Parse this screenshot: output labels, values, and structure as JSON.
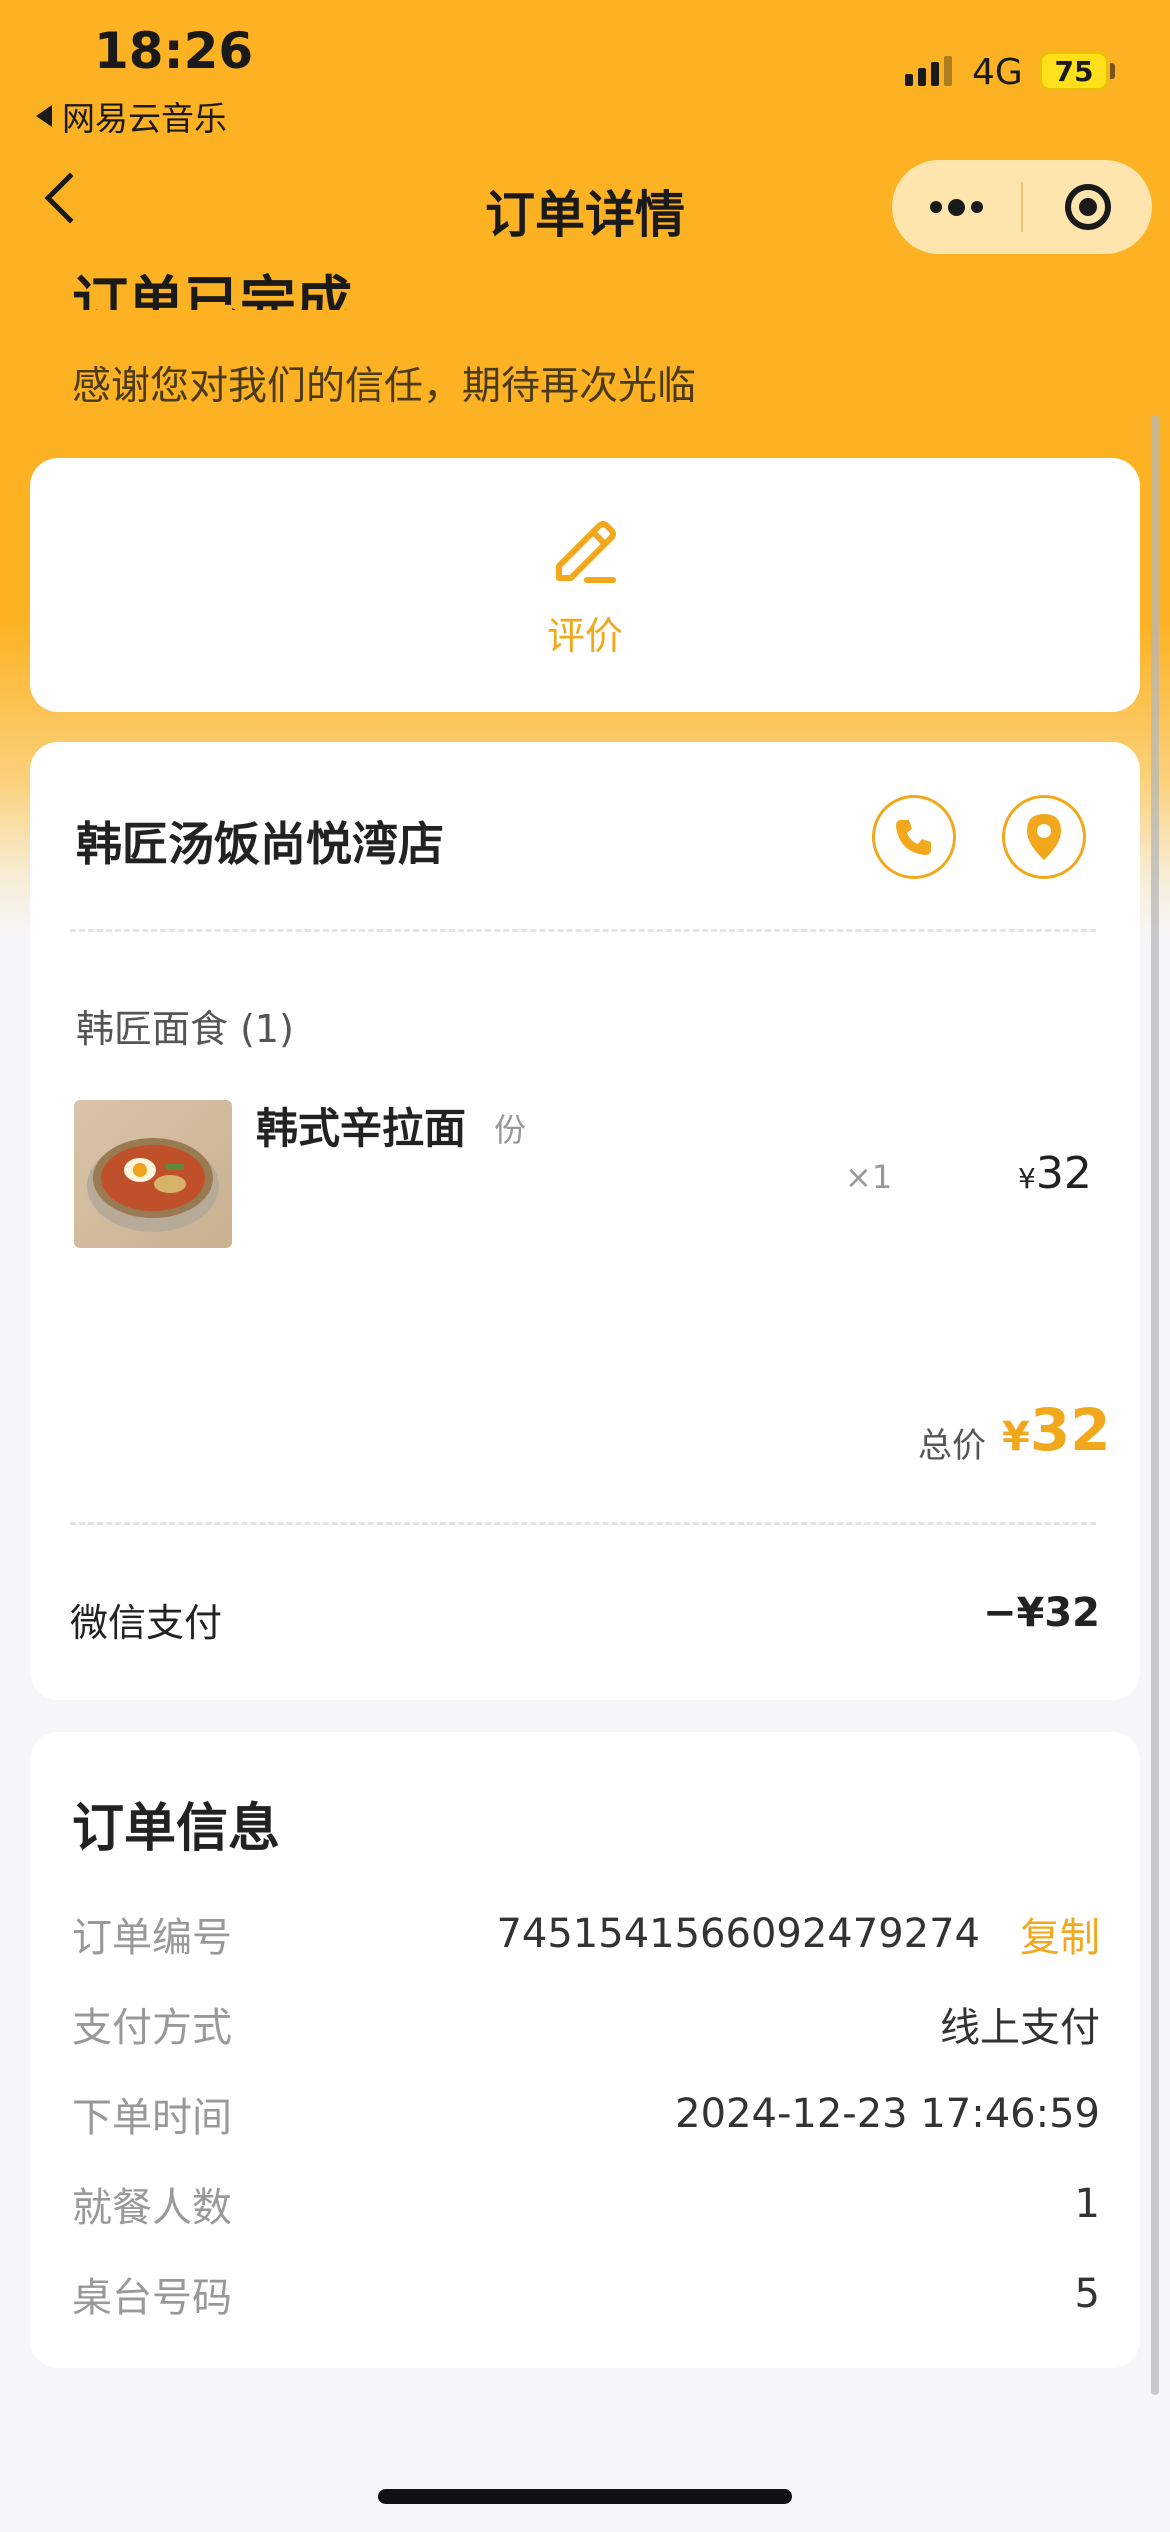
{
  "status_bar": {
    "time": "18:26",
    "back_app": "网易云音乐",
    "network": "4G",
    "battery": "75"
  },
  "nav": {
    "title": "订单详情",
    "back_icon": "chevron-left-icon",
    "more_icon": "more-dots-icon",
    "close_icon": "target-close-icon"
  },
  "order_status": {
    "title": "订单已完成",
    "subtitle": "感谢您对我们的信任，期待再次光临"
  },
  "review": {
    "label": "评价",
    "icon": "pencil-icon"
  },
  "shop": {
    "name": "韩匠汤饭尚悦湾店",
    "phone_icon": "phone-icon",
    "location_icon": "location-pin-icon",
    "category": "韩匠面食 (1)",
    "items": [
      {
        "name": "韩式辛拉面",
        "unit": "份",
        "qty": "×1",
        "currency": "¥",
        "price": "32"
      }
    ],
    "total_label": "总价",
    "total_currency": "¥",
    "total_value": "32",
    "payment_method_label": "微信支付",
    "payment_amount": "−¥32"
  },
  "order_info": {
    "title": "订单信息",
    "rows": [
      {
        "label": "订单编号",
        "value": "7451541566092479274",
        "action": "复制"
      },
      {
        "label": "支付方式",
        "value": "线上支付"
      },
      {
        "label": "下单时间",
        "value": "2024-12-23 17:46:59"
      },
      {
        "label": "就餐人数",
        "value": "1"
      },
      {
        "label": "桌台号码",
        "value": "5"
      }
    ]
  },
  "colors": {
    "accent": "#f2a81c",
    "header_bg": "#fcb222",
    "page_bg": "#f6f7f9"
  }
}
